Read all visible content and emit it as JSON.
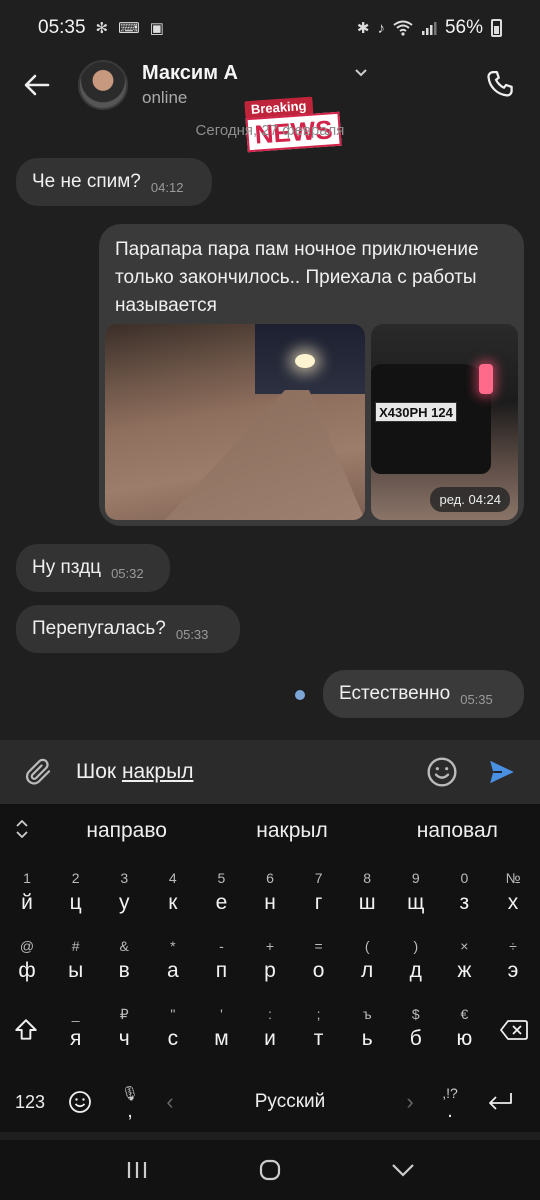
{
  "status_bar": {
    "time": "05:35",
    "battery": "56%"
  },
  "header": {
    "contact_name": "Максим А",
    "contact_status": "online",
    "sticker_top": "Breaking",
    "sticker_bottom": "NEWS"
  },
  "chat": {
    "date_separator": "Сегодня, 27 февраля",
    "messages": [
      {
        "text": "Че не спим?",
        "time": "04:12",
        "direction": "in"
      },
      {
        "text": "Парапара пара пам ночное приключение только закончилось.. Приехала с работы называется",
        "time": "ред. 04:24",
        "direction": "out",
        "plate": "X430PH 124"
      },
      {
        "text": "Ну пздц",
        "time": "05:32",
        "direction": "in"
      },
      {
        "text": "Перепугалась?",
        "time": "05:33",
        "direction": "in"
      },
      {
        "text": "Естественно",
        "time": "05:35",
        "direction": "out"
      }
    ]
  },
  "input": {
    "text_plain": "Шок ",
    "text_underlined": "накрыл"
  },
  "keyboard": {
    "suggestions": [
      "направо",
      "накрыл",
      "наповал"
    ],
    "row1": [
      {
        "sym": "1",
        "ch": "й"
      },
      {
        "sym": "2",
        "ch": "ц"
      },
      {
        "sym": "3",
        "ch": "у"
      },
      {
        "sym": "4",
        "ch": "к"
      },
      {
        "sym": "5",
        "ch": "е"
      },
      {
        "sym": "6",
        "ch": "н"
      },
      {
        "sym": "7",
        "ch": "г"
      },
      {
        "sym": "8",
        "ch": "ш"
      },
      {
        "sym": "9",
        "ch": "щ"
      },
      {
        "sym": "0",
        "ch": "з"
      },
      {
        "sym": "№",
        "ch": "х"
      }
    ],
    "row2": [
      {
        "sym": "@",
        "ch": "ф"
      },
      {
        "sym": "#",
        "ch": "ы"
      },
      {
        "sym": "&",
        "ch": "в"
      },
      {
        "sym": "*",
        "ch": "а"
      },
      {
        "sym": "-",
        "ch": "п"
      },
      {
        "sym": "+",
        "ch": "р"
      },
      {
        "sym": "=",
        "ch": "о"
      },
      {
        "sym": "(",
        "ch": "л"
      },
      {
        "sym": ")",
        "ch": "д"
      },
      {
        "sym": "×",
        "ch": "ж"
      },
      {
        "sym": "÷",
        "ch": "э"
      }
    ],
    "row3": [
      {
        "sym": "_",
        "ch": "я"
      },
      {
        "sym": "₽",
        "ch": "ч"
      },
      {
        "sym": "\"",
        "ch": "с"
      },
      {
        "sym": "'",
        "ch": "м"
      },
      {
        "sym": ":",
        "ch": "и"
      },
      {
        "sym": ";",
        "ch": "т"
      },
      {
        "sym": "ъ",
        "ch": "ь"
      },
      {
        "sym": "$",
        "ch": "б"
      },
      {
        "sym": "€",
        "ch": "ю"
      }
    ],
    "key_123": "123",
    "space_label": "Русский",
    "mic_bottom": ",",
    "punct_top": ",!?",
    "punct_bottom": "."
  },
  "colors": {
    "background": "#1f1f1f",
    "bubble_in": "#333333",
    "bubble_out": "#3a3a3a",
    "send_accent": "#4a90e2",
    "unread_dot": "#7ba6d6"
  }
}
